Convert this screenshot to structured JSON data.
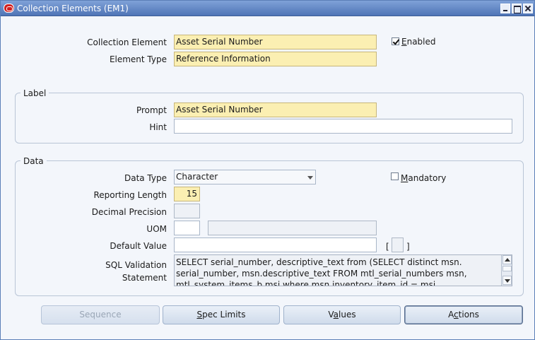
{
  "window": {
    "title": "Collection Elements (EM1)"
  },
  "header": {
    "collection_element_label": "Collection Element",
    "collection_element_value": "Asset Serial Number",
    "element_type_label": "Element Type",
    "element_type_value": "Reference Information",
    "enabled_label": "Enabled",
    "enabled_checked": true
  },
  "label_group": {
    "title": "Label",
    "prompt_label": "Prompt",
    "prompt_value": "Asset Serial Number",
    "hint_label": "Hint",
    "hint_value": ""
  },
  "data_group": {
    "title": "Data",
    "data_type_label": "Data Type",
    "data_type_value": "Character",
    "mandatory_label": "Mandatory",
    "mandatory_checked": false,
    "reporting_length_label": "Reporting Length",
    "reporting_length_value": "15",
    "decimal_precision_label": "Decimal Precision",
    "decimal_precision_value": "",
    "uom_label": "UOM",
    "uom_value": "",
    "uom_desc_value": "",
    "default_value_label": "Default Value",
    "default_value_value": "",
    "bracket_open": "[",
    "bracket_close": "]",
    "sql_label_line1": "SQL Validation",
    "sql_label_line2": "Statement",
    "sql_value": "SELECT serial_number, descriptive_text from (SELECT distinct msn. serial_number, msn.descriptive_text FROM mtl_serial_numbers msn, mtl_system_items_b msi where msn.inventory_item_id = msi."
  },
  "buttons": {
    "sequence": "Sequence",
    "spec_limits_first": "S",
    "spec_limits_rest": "pec Limits",
    "values_pre": "V",
    "values_u": "a",
    "values_post": "lues",
    "actions_pre": "A",
    "actions_u": "c",
    "actions_post": "tions"
  }
}
